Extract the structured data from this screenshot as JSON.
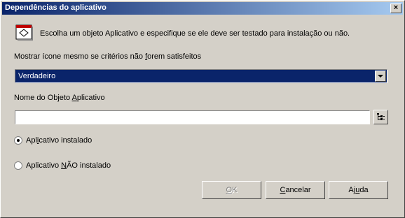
{
  "window": {
    "title": "Dependências do aplicativo",
    "close_label": "×"
  },
  "instruction": "Escolha um objeto Aplicativo e especifique se ele deve ser testado para instalação ou não.",
  "show_icon": {
    "label_pre": "Mostrar ícone mesmo se critérios não ",
    "label_mnemonic": "f",
    "label_post": "orem satisfeitos",
    "selected_value": "Verdadeiro"
  },
  "app_object": {
    "label_pre": "Nome do Objeto ",
    "label_mnemonic": "A",
    "label_post": "plicativo",
    "value": ""
  },
  "radios": {
    "installed": {
      "pre": "Apl",
      "mnemonic": "i",
      "post": "cativo instalado",
      "checked": true
    },
    "not_installed": {
      "pre": "Aplicativo ",
      "mnemonic": "N",
      "post": "ÃO instalado",
      "checked": false
    }
  },
  "buttons": {
    "ok": {
      "mnemonic": "O",
      "rest": "K"
    },
    "cancel": {
      "mnemonic": "C",
      "rest": "ancelar"
    },
    "help": {
      "pre": "Aj",
      "mnemonic": "u",
      "rest": "da"
    }
  },
  "colors": {
    "selection": "#0a246a",
    "face": "#d4d0c8"
  }
}
